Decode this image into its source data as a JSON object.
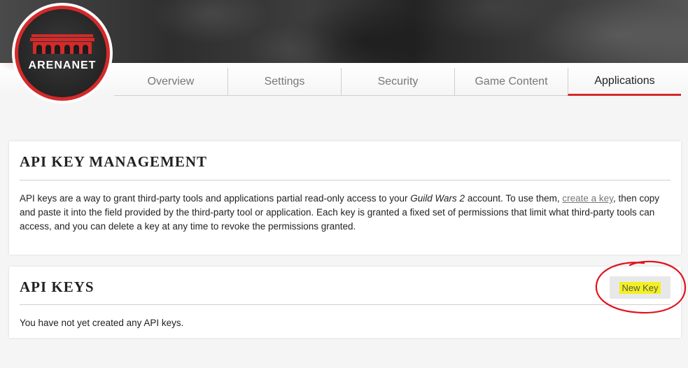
{
  "logo": {
    "text": "ARENANET",
    "ring_color": "#d42a2a"
  },
  "tabs": [
    {
      "label": "Overview",
      "active": false
    },
    {
      "label": "Settings",
      "active": false
    },
    {
      "label": "Security",
      "active": false
    },
    {
      "label": "Game Content",
      "active": false
    },
    {
      "label": "Applications",
      "active": true
    }
  ],
  "management": {
    "title": "API KEY MANAGEMENT",
    "desc_1": "API keys are a way to grant third-party tools and applications partial read-only access to your ",
    "game_name": "Guild Wars 2",
    "desc_2": " account. To use them, ",
    "link_text": "create a key",
    "desc_3": ", then copy and paste it into the field provided by the third-party tool or application. Each key is granted a fixed set of permissions that limit what third-party tools can access, and you can delete a key at any time to revoke the permissions granted."
  },
  "keys": {
    "title": "API KEYS",
    "new_key_label": "New Key",
    "empty_text": "You have not yet created any API keys."
  },
  "colors": {
    "accent": "#d42a2a",
    "highlight": "#f3f020",
    "annotation": "#e0121c"
  }
}
